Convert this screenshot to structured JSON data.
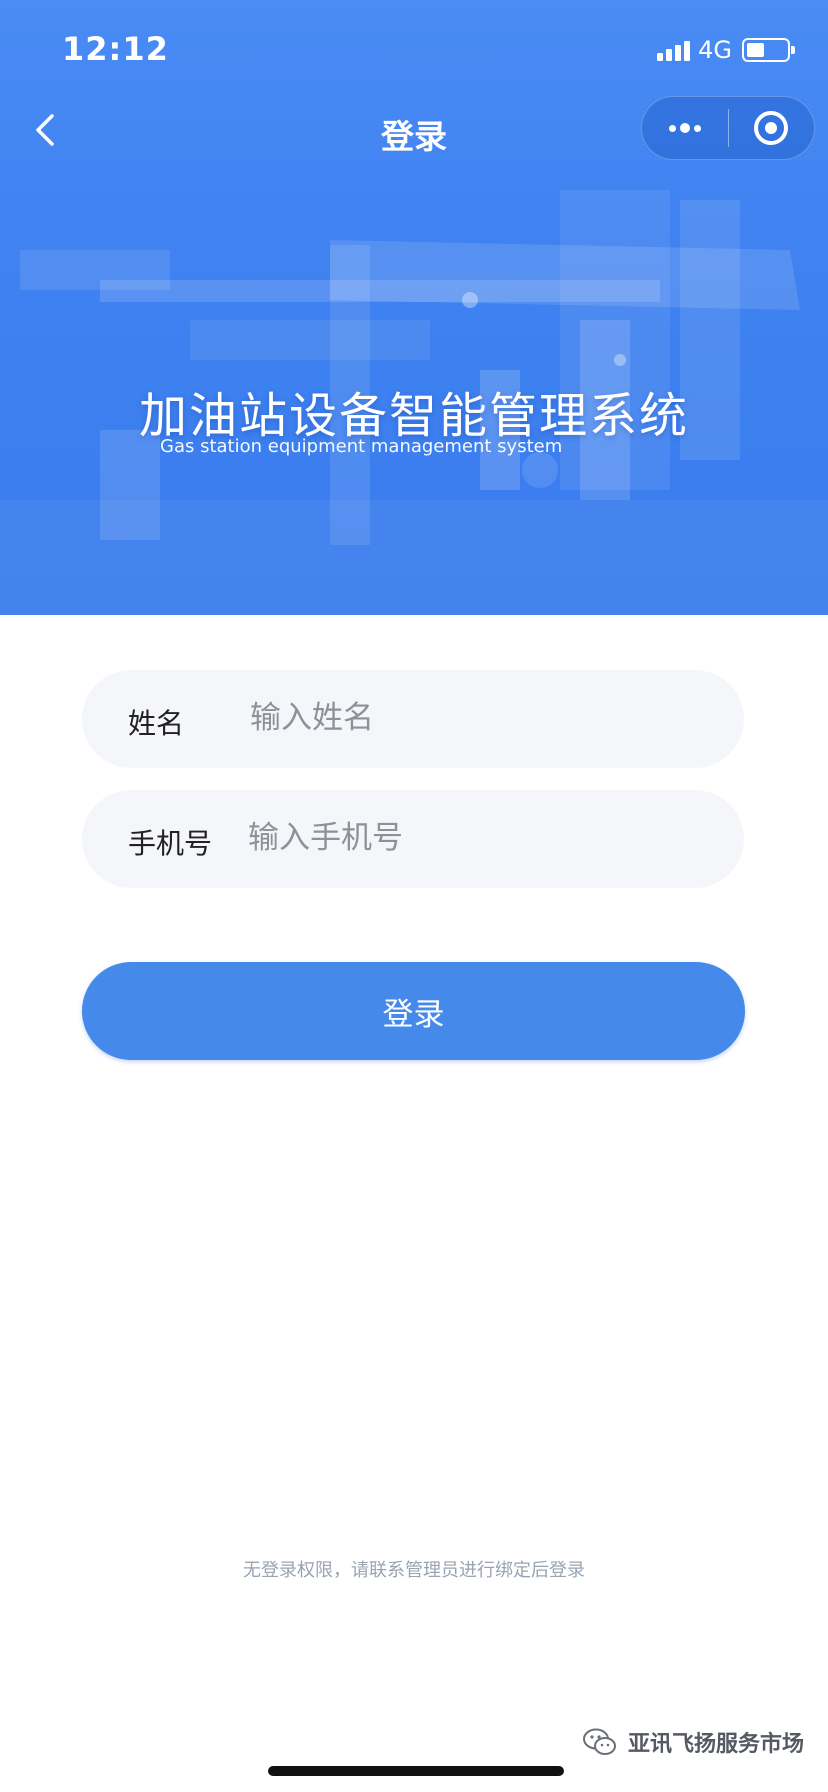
{
  "status_bar": {
    "time": "12:12",
    "network": "4G",
    "battery_level": 0.45
  },
  "nav": {
    "title": "登录",
    "icons": [
      "chevron-left-icon",
      "more-icon",
      "target-icon"
    ]
  },
  "hero": {
    "title": "加油站设备智能管理系统",
    "subtitle": "Gas station equipment management system",
    "background_color": "#3f82f0"
  },
  "form": {
    "name": {
      "label": "姓名",
      "placeholder": "输入姓名",
      "value": ""
    },
    "phone": {
      "label": "手机号",
      "placeholder": "输入手机号",
      "value": ""
    },
    "submit_label": "登录",
    "button_color": "#4589ea"
  },
  "hint": "无登录权限，请联系管理员进行绑定后登录",
  "watermark": {
    "icon": "wechat-icon",
    "text": "亚讯飞扬服务市场"
  }
}
